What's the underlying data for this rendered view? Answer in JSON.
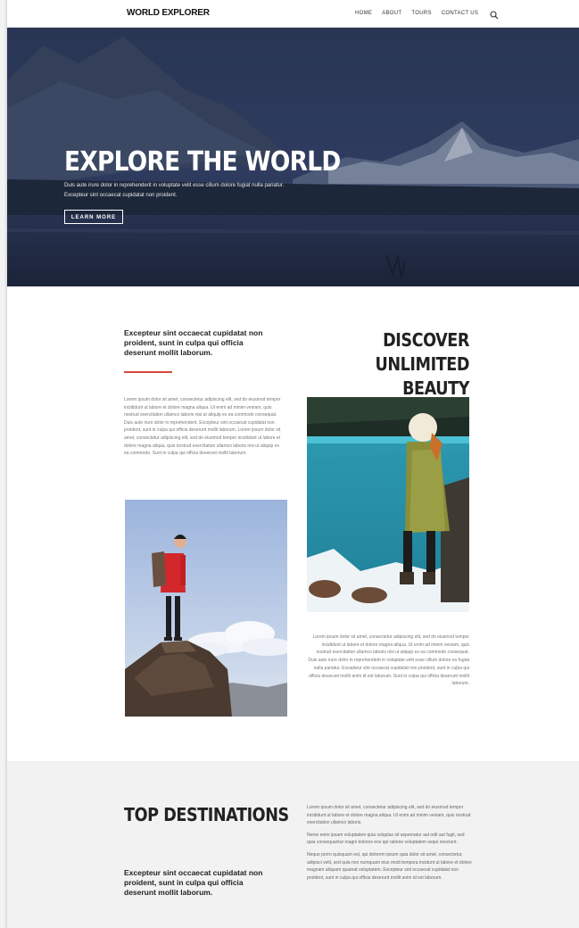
{
  "nav": {
    "brand": "WORLD EXPLORER",
    "items": [
      "HOME",
      "ABOUT",
      "TOURS",
      "CONTACT US"
    ],
    "search_icon": "search-icon"
  },
  "hero": {
    "title": "EXPLORE THE WORLD",
    "text": "Duis aute irure dolor in reprehenderit in voluptate velit esse cillum dolore fugiat nulla pariatur. Excepteur sint occaecat cupidatat non proident.",
    "button": "LEARN MORE"
  },
  "discover": {
    "intro": "Excepteur sint occaecat cupidatat non proident, sunt in culpa qui officia deserunt mollit laborum.",
    "title_line1": "DISCOVER",
    "title_line2": "UNLIMITED BEAUTY",
    "para_left": "Lorem ipsum dolor sit amet, consectetur adipiscing elit, sed do eiusmod tempor incididunt ut labore et dolore magna aliqua. Ut enim ad minim veniam, quis nostrud exercitation ullamco laboris nisi ut aliquip ex ea commodo consequat. Duis aute irure dolor in reprehenderit. Excepteur sint occaecat cupidatat non proident, sunt in culpa qui officia deserunt mollit laborum. Lorem ipsum dolor sit amet, consectetur adipiscing elit, sed do eiusmod tempor incididunt ut labore et dolore magna aliqua, quis nostrud exercitation ullamco laboris nisi ut aliquip ex ea commodo. Sunt in culpa qui officia deserunt mollit laborum.",
    "para_right": "Lorem ipsum dolor sit amet, consectetur adipiscing elit, sed do eiusmod tempor incididunt ut labore et dolore magna aliqua. Ut enim ad minim veniam, quis nostrud exercitation ullamco laboris nisi ut aliquip ex ea commodo consequat. Duis aute irure dolor in reprehenderit in voluptate velit esse cillum dolore eu fugiat nulla pariatur. Excepteur sint occaecat cupidatat non proident, sunt in culpa qui officia deserunt mollit anim id est laborum. Sunt in culpa qui officia deserunt mollit laborum."
  },
  "destinations": {
    "title": "TOP DESTINATIONS",
    "intro": "Excepteur sint occaecat cupidatat non proident, sunt in culpa qui officia deserunt mollit laborum.",
    "para1": "Lorem ipsum dolor sit amet, consectetur adipiscing elit, sed do eiusmod tempor incididunt ut labore et dolore magna aliqua. Ut enim ad minim veniam, quis nostrud exercitation ullamco laboris.",
    "para2": "Nemo enim ipsam voluptatem quia voluptas sit aspernatur aut odit aut fugit, sed quia consequuntur magni dolores eos qui ratione voluptatem sequi nesciunt.",
    "para3": "Neque porro quisquam est, qui dolorem ipsum quia dolor sit amet, consectetur, adipisci velit, sed quia non numquam eius modi tempora incidunt ut labore et dolore magnam aliquam quaerat voluptatem. Excepteur sint occaecat cupidatat non proident, sunt in culpa qui officia deserunt mollit anim id est laborum."
  },
  "colors": {
    "accent_red": "#d44a3a",
    "hero_overlay": "#2a3650",
    "section_gray": "#f2f2f2"
  }
}
